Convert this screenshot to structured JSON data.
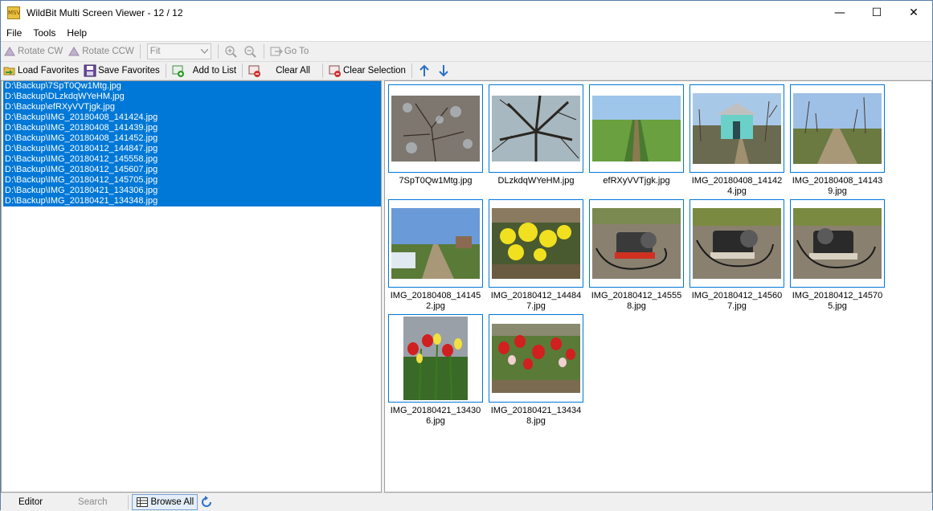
{
  "window": {
    "title": "WildBit Multi Screen Viewer - 12 / 12",
    "app_icon_text": "MSV",
    "minimize": "—",
    "maximize": "☐",
    "close": "✕"
  },
  "menu": {
    "items": [
      "File",
      "Tools",
      "Help"
    ]
  },
  "toolbar1": {
    "rotate_cw": "Rotate CW",
    "rotate_ccw": "Rotate CCW",
    "zoom_select": "Fit",
    "go_to": "Go To"
  },
  "toolbar2": {
    "load_favorites": "Load Favorites",
    "save_favorites": "Save Favorites",
    "add_to_list": "Add to List",
    "clear_all": "Clear All",
    "clear_selection": "Clear Selection"
  },
  "file_list": [
    "D:\\Backup\\7SpT0Qw1Mtg.jpg",
    "D:\\Backup\\DLzkdqWYeHM.jpg",
    "D:\\Backup\\efRXyVVTjgk.jpg",
    "D:\\Backup\\IMG_20180408_141424.jpg",
    "D:\\Backup\\IMG_20180408_141439.jpg",
    "D:\\Backup\\IMG_20180408_141452.jpg",
    "D:\\Backup\\IMG_20180412_144847.jpg",
    "D:\\Backup\\IMG_20180412_145558.jpg",
    "D:\\Backup\\IMG_20180412_145607.jpg",
    "D:\\Backup\\IMG_20180412_145705.jpg",
    "D:\\Backup\\IMG_20180421_134306.jpg",
    "D:\\Backup\\IMG_20180421_134348.jpg"
  ],
  "thumbnails": [
    {
      "label": "7SpT0Qw1Mtg.jpg",
      "scene": "tree-blossom"
    },
    {
      "label": "DLzkdqWYeHM.jpg",
      "scene": "tree-branches"
    },
    {
      "label": "efRXyVVTjgk.jpg",
      "scene": "green-field"
    },
    {
      "label": "IMG_20180408_141424.jpg",
      "scene": "house"
    },
    {
      "label": "IMG_20180408_141439.jpg",
      "scene": "dirt-road"
    },
    {
      "label": "IMG_20180408_141452.jpg",
      "scene": "dirt-road-2"
    },
    {
      "label": "IMG_20180412_144847.jpg",
      "scene": "yellow-flowers"
    },
    {
      "label": "IMG_20180412_145558.jpg",
      "scene": "pump"
    },
    {
      "label": "IMG_20180412_145607.jpg",
      "scene": "pump"
    },
    {
      "label": "IMG_20180412_145705.jpg",
      "scene": "pump"
    },
    {
      "label": "IMG_20180421_134306.jpg",
      "scene": "tulips-portrait"
    },
    {
      "label": "IMG_20180421_134348.jpg",
      "scene": "tulips"
    }
  ],
  "statusbar": {
    "editor": "Editor",
    "search": "Search",
    "browse_all": "Browse All"
  },
  "colors": {
    "selection": "#0078d7",
    "thumb_border": "#0078d7",
    "arrow_blue": "#2a6fc9"
  }
}
